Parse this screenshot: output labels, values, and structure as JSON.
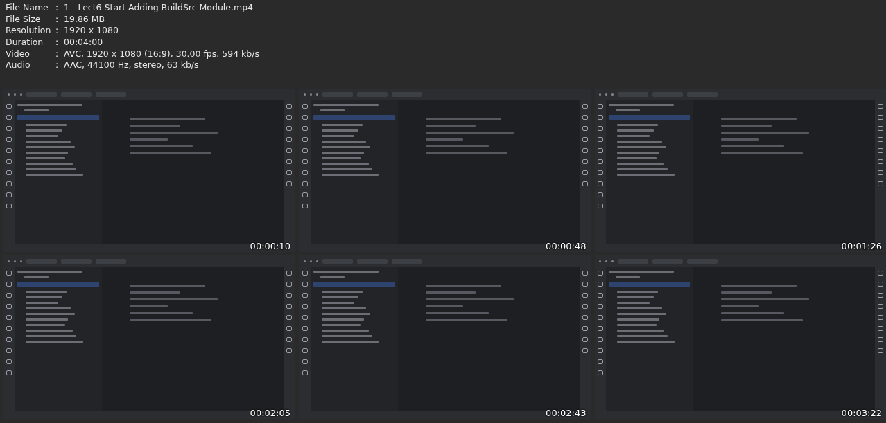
{
  "file_info": [
    {
      "label": "File Name",
      "separator": ":",
      "value": "1 - Lect6 Start Adding BuildSrc Module.mp4"
    },
    {
      "label": "File Size",
      "separator": ":",
      "value": "19.86 MB"
    },
    {
      "label": "Resolution",
      "separator": ":",
      "value": "1920 x 1080"
    },
    {
      "label": "Duration",
      "separator": ":",
      "value": "00:04:00"
    },
    {
      "label": "Video",
      "separator": ":",
      "value": "AVC, 1920 x 1080 (16:9), 30.00 fps, 594 kb/s"
    },
    {
      "label": "Audio",
      "separator": ":",
      "value": "AAC, 44100 Hz, stereo, 63 kb/s"
    }
  ],
  "frames": [
    {
      "timestamp": "00:00:10"
    },
    {
      "timestamp": "00:00:48"
    },
    {
      "timestamp": "00:01:26"
    },
    {
      "timestamp": "00:02:05"
    },
    {
      "timestamp": "00:02:43"
    },
    {
      "timestamp": "00:03:22"
    }
  ]
}
